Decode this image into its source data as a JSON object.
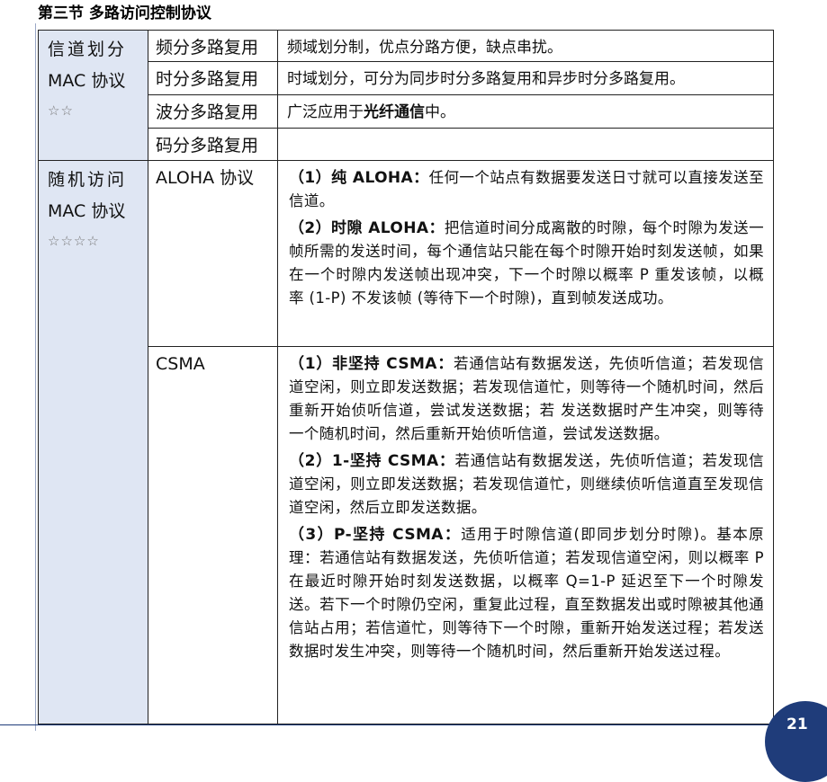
{
  "heading": "第三节 多路访问控制协议",
  "groups": [
    {
      "category_line1": "信道划分",
      "category_line2": "MAC 协议",
      "stars": "☆☆",
      "rows": [
        {
          "name": "频分多路复用",
          "desc": "频域划分制，优点分路方便，缺点串扰。"
        },
        {
          "name": "时分多路复用",
          "desc": "时域划分，可分为同步时分多路复用和异步时分多路复用。"
        },
        {
          "name": "波分多路复用",
          "desc_pre": "广泛应用于",
          "desc_bold": "光纤通信",
          "desc_post": "中。"
        },
        {
          "name": "码分多路复用",
          "desc": ""
        }
      ]
    },
    {
      "category_line1": "随机访问",
      "category_line2": "MAC 协议",
      "stars": "☆☆☆☆",
      "aloha": {
        "name": "ALOHA 协议",
        "p1_label": "（1）纯 ALOHA：",
        "p1_text": "任何一个站点有数据要发送日寸就可以直接发送至信道。",
        "p2_label": "（2）时隙 ALOHA：",
        "p2_text": "把信道时间分成离散的时隙，每个时隙为发送一帧所需的发送时间，每个通信站只能在每个时隙开始时刻发送帧，如果在一个时隙内发送帧出现冲突，下一个时隙以概率 P 重发该帧，以概率 (1-P) 不发该帧 (等待下一个时隙)，直到帧发送成功。"
      },
      "csma": {
        "name": "CSMA",
        "p1_label": "（1）非坚持 CSMA：",
        "p1_text": "若通信站有数据发送，先侦听信道；若发现信道空闲，则立即发送数据；若发现信道忙，则等待一个随机时间，然后重新开始侦听信道，尝试发送数据；若 发送数据时产生冲突，则等待一个随机时间，然后重新开始侦听信道，尝试发送数据。",
        "p2_label": "（2）1-坚持 CSMA：",
        "p2_text": "若通信站有数据发送，先侦听信道；若发现信道空闲，则立即发送数据；若发现信道忙，则继续侦听信道直至发现信道空闲，然后立即发送数据。",
        "p3_label": "（3）P-坚持 CSMA：",
        "p3_text": "适用于时隙信道(即同步划分时隙)。基本原理：若通信站有数据发送，先侦听信道；若发现信道空闲，则以概率 P 在最近时隙开始时刻发送数据，以概率 Q=1-P 延迟至下一个时隙发送。若下一个时隙仍空闲，重复此过程，直至数据发出或时隙被其他通信站占用；若信道忙，则等待下一个时隙，重新开始发送过程；若发送数据时发生冲突，则等待一个随机时间，然后重新开始发送过程。"
      }
    }
  ],
  "page_number": "21"
}
